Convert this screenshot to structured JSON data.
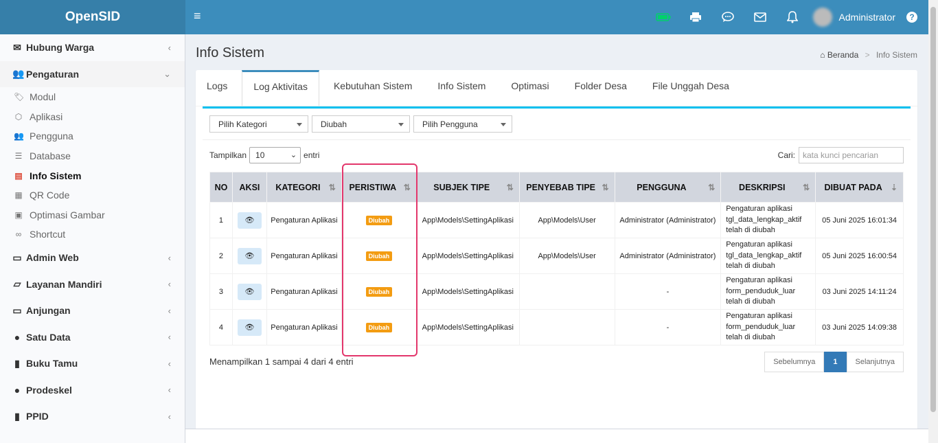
{
  "header": {
    "brand": "OpenSID",
    "menu_toggle": "≡",
    "user": "Administrator",
    "help": "?",
    "icons": [
      "battery-icon",
      "printer-icon",
      "chat-icon",
      "mail-icon",
      "bell-icon"
    ]
  },
  "sidebar": {
    "items": [
      {
        "label": "Hubung Warga",
        "icon": "envelope-icon",
        "glyph": "✉"
      },
      {
        "label": "Pengaturan",
        "icon": "users-icon",
        "glyph": "👥",
        "open": true
      },
      {
        "label": "Admin Web",
        "icon": "desktop-icon",
        "glyph": "🖥"
      },
      {
        "label": "Layanan Mandiri",
        "icon": "inbox-icon",
        "glyph": "📥"
      },
      {
        "label": "Anjungan",
        "icon": "monitor-icon",
        "glyph": "🖥"
      },
      {
        "label": "Satu Data",
        "icon": "globe-icon",
        "glyph": "🌐"
      },
      {
        "label": "Buku Tamu",
        "icon": "book-icon",
        "glyph": "📘"
      },
      {
        "label": "Prodeskel",
        "icon": "globe-icon",
        "glyph": "🌐"
      },
      {
        "label": "PPID",
        "icon": "book-icon",
        "glyph": "📕"
      }
    ],
    "sub_items": [
      {
        "label": "Modul",
        "icon": "tags-icon",
        "glyph": "🏷"
      },
      {
        "label": "Aplikasi",
        "icon": "cube-icon",
        "glyph": "⬡"
      },
      {
        "label": "Pengguna",
        "icon": "users-icon",
        "glyph": "👥"
      },
      {
        "label": "Database",
        "icon": "database-icon",
        "glyph": "🛢"
      },
      {
        "label": "Info Sistem",
        "icon": "server-icon",
        "glyph": "▤",
        "active": true
      },
      {
        "label": "QR Code",
        "icon": "qrcode-icon",
        "glyph": "▦"
      },
      {
        "label": "Optimasi Gambar",
        "icon": "image-icon",
        "glyph": "🖼"
      },
      {
        "label": "Shortcut",
        "icon": "link-icon",
        "glyph": "🔗"
      }
    ]
  },
  "page": {
    "title": "Info Sistem",
    "breadcrumb_home": "Beranda",
    "breadcrumb_sep": ">",
    "breadcrumb_current": "Info Sistem"
  },
  "tabs": [
    "Logs",
    "Log Aktivitas",
    "Kebutuhan Sistem",
    "Info Sistem",
    "Optimasi",
    "Folder Desa",
    "File Unggah Desa"
  ],
  "filters": {
    "kategori": "Pilih Kategori",
    "peristiwa": "Diubah",
    "pengguna": "Pilih Pengguna"
  },
  "table_controls": {
    "show_label": "Tampilkan",
    "show_value": "10",
    "entries_label": "entri",
    "search_label": "Cari:",
    "search_placeholder": "kata kunci pencarian"
  },
  "table": {
    "columns": [
      "NO",
      "AKSI",
      "KATEGORI",
      "PERISTIWA",
      "SUBJEK TIPE",
      "PENYEBAB TIPE",
      "PENGGUNA",
      "DESKRIPSI",
      "DIBUAT PADA"
    ],
    "rows": [
      {
        "no": "1",
        "kategori": "Pengaturan Aplikasi",
        "peristiwa": "Diubah",
        "subjek": "App\\Models\\SettingAplikasi",
        "penyebab": "App\\Models\\User",
        "pengguna": "Administrator (Administrator)",
        "deskripsi": [
          "Pengaturan aplikasi",
          "tgl_data_lengkap_aktif",
          "telah di diubah"
        ],
        "dibuat": "05 Juni 2025 16:01:34"
      },
      {
        "no": "2",
        "kategori": "Pengaturan Aplikasi",
        "peristiwa": "Diubah",
        "subjek": "App\\Models\\SettingAplikasi",
        "penyebab": "App\\Models\\User",
        "pengguna": "Administrator (Administrator)",
        "deskripsi": [
          "Pengaturan aplikasi",
          "tgl_data_lengkap_aktif",
          "telah di diubah"
        ],
        "dibuat": "05 Juni 2025 16:00:54"
      },
      {
        "no": "3",
        "kategori": "Pengaturan Aplikasi",
        "peristiwa": "Diubah",
        "subjek": "App\\Models\\SettingAplikasi",
        "penyebab": "",
        "pengguna": "-",
        "deskripsi": [
          "Pengaturan aplikasi",
          "form_penduduk_luar",
          "telah di diubah"
        ],
        "dibuat": "03 Juni 2025 14:11:24"
      },
      {
        "no": "4",
        "kategori": "Pengaturan Aplikasi",
        "peristiwa": "Diubah",
        "subjek": "App\\Models\\SettingAplikasi",
        "penyebab": "",
        "pengguna": "-",
        "deskripsi": [
          "Pengaturan aplikasi",
          "form_penduduk_luar",
          "telah di diubah"
        ],
        "dibuat": "03 Juni 2025 14:09:38"
      }
    ]
  },
  "footer_info": "Menampilkan 1 sampai 4 dari 4 entri",
  "pagination": {
    "prev": "Sebelumnya",
    "current": "1",
    "next": "Selanjutnya"
  },
  "colors": {
    "primary": "#3c8dbc",
    "badge": "#f39c12",
    "highlight": "#e3366b",
    "tab_line": "#00c0ef"
  }
}
